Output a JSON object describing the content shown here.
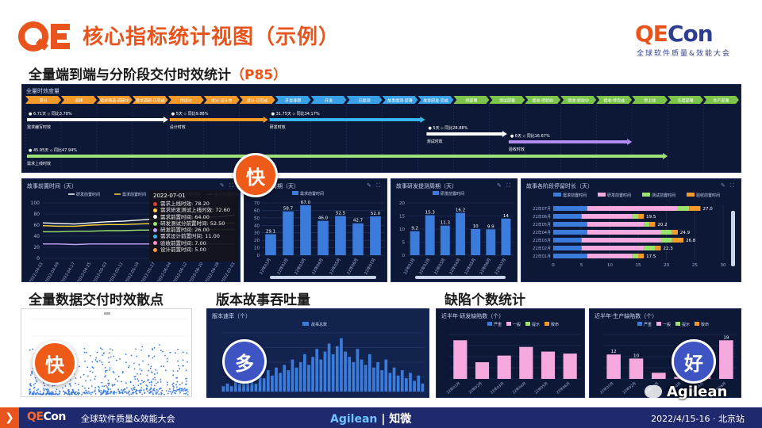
{
  "header": {
    "logo_text": "QE",
    "title": "核心指标统计视图（示例）",
    "brand_qe": "QE",
    "brand_con": "Con",
    "brand_subtitle": "全球软件质量&效能大会"
  },
  "sections": {
    "end_to_end_title": "全量端到端与分阶段交付时效统计",
    "end_to_end_ref": "（P85）",
    "scatter_title": "全量数据交付时效散点",
    "throughput_title": "版本故事吞吐量",
    "defect_title": "缺陷个数统计"
  },
  "badges": {
    "fast_1": "快",
    "fast_2": "快",
    "many": "多",
    "good": "好"
  },
  "gantt": {
    "header": "全量时效度量",
    "stages": [
      "需分",
      "选择",
      "需求筛选·调研中",
      "需求调研·已完成",
      "待设计",
      "设计·设计中",
      "设计·已完成",
      "开发排期",
      "开发",
      "已提测",
      "故事提测·部署",
      "故事研发·完成",
      "待部署",
      "测试部署",
      "验收·待验收",
      "验收·验收中",
      "验收·待完成",
      "待上线",
      "灰度部署",
      "生产部署"
    ],
    "stage_colors": [
      "#f39a2a",
      "#f39a2a",
      "#f39a2a",
      "#f39a2a",
      "#f39a2a",
      "#f39a2a",
      "#f39a2a",
      "#3aa0e8",
      "#3aa0e8",
      "#3aa0e8",
      "#3aa0e8",
      "#3aa0e8",
      "#7cc54a",
      "#7cc54a",
      "#7cc54a",
      "#7cc54a",
      "#7cc54a",
      "#7cc54a",
      "#7cc54a",
      "#7cc54a"
    ],
    "bars": [
      {
        "label": "需求编写时效",
        "value": "6.71天",
        "pct": "同比3.78%",
        "color": "#ffffff"
      },
      {
        "label": "设计时效",
        "value": "5天",
        "pct": "同比9.88%",
        "color": "#f39a2a"
      },
      {
        "label": "研发时效",
        "value": "31.75天",
        "pct": "同比34.17%",
        "color": "#37b6f0"
      },
      {
        "label": "测试时效",
        "value": "5天",
        "pct": "同比28.88%",
        "color": "#ffffff"
      },
      {
        "label": "验收时效",
        "value": "6天",
        "pct": "同比16.67%",
        "color": "#b28cf2"
      },
      {
        "label": "需求上线时效",
        "value": "45.95天",
        "pct": "同比47.94%",
        "color": "#9fe27a"
      }
    ]
  },
  "panels": {
    "line_title": "故事前置时间（天）",
    "line_legend": [
      "研发前置时间",
      "需求前置时间",
      "需求设计前置时间",
      "设计前置时间"
    ],
    "dev_cycle_title": "故事开发周期（天）",
    "dev_cycle_legend": "需求前置时间",
    "dev_test_title": "故事研发提测周期（天）",
    "dev_test_legend": "研发前置时间",
    "stage_title": "故事各阶段停留时长（天）",
    "stage_legend": [
      "需求前置时间",
      "研发前置时间",
      "测试前置时间",
      "验收前置时间"
    ],
    "throughput_title": "版本速率（个）",
    "throughput_legend": "故事总数",
    "defect_left_title": "近半年·研发缺陷数（个）",
    "defect_right_title": "近半年·生产缺陷数（个）",
    "defect_legend": [
      "严重",
      "一般",
      "提示",
      "致命"
    ],
    "defect_right_values": [
      "12",
      "10",
      "19"
    ]
  },
  "tooltip": {
    "date": "2022-07-01",
    "rows": [
      {
        "text": "需求上线时效: 78.20",
        "color": "#e63a3a"
      },
      {
        "text": "需求研发测试上线时效: 72.60",
        "color": "#ffd23c"
      },
      {
        "text": "需求前置时间: 64.00",
        "color": "#ffffff"
      },
      {
        "text": "研发测试分前置时间: 52.50",
        "color": "#9be36a"
      },
      {
        "text": "研发前置时间: 26.00",
        "color": "#c6a2ff"
      },
      {
        "text": "需求设计前置时间: 11.00",
        "color": "#37b6f0"
      },
      {
        "text": "验收前置时间: 7.00",
        "color": "#ff8ad0"
      },
      {
        "text": "设计前置时间: 5.00",
        "color": "#ff9c3a"
      }
    ]
  },
  "chart_data": [
    {
      "type": "line",
      "title": "故事前置时间（天）",
      "x": [
        "2022-04-01",
        "2022-04-09",
        "2022-04-17",
        "2022-04-25",
        "2022-05-03",
        "2022-05-11",
        "2022-05-19",
        "2022-05-27",
        "2022-06-04",
        "2022-06-12",
        "2022-06-20",
        "2022-06-28",
        "2022-07-01"
      ],
      "ylim": [
        0,
        100
      ],
      "yticks": [
        "0",
        "20",
        "40",
        "60",
        "80",
        "100"
      ],
      "series": [
        {
          "name": "研发前置时间",
          "values": [
            64,
            63,
            62,
            64,
            66,
            67,
            69,
            71,
            72,
            73,
            74,
            75,
            78
          ],
          "color": "#ffffff"
        },
        {
          "name": "需求前置时间",
          "values": [
            59,
            58,
            58,
            60,
            61,
            61,
            62,
            63,
            64,
            64,
            64,
            63,
            64
          ],
          "color": "#ffd23c"
        },
        {
          "name": "需求设计前置时间",
          "values": [
            48,
            48,
            49,
            49,
            50,
            50,
            51,
            51,
            52,
            52,
            52,
            52,
            52
          ],
          "color": "#9be36a"
        },
        {
          "name": "设计前置时间",
          "values": [
            26,
            26,
            25,
            26,
            26,
            26,
            26,
            26,
            26,
            26,
            26,
            26,
            26
          ],
          "color": "#c6a2ff"
        }
      ]
    },
    {
      "type": "bar",
      "title": "故事开发周期（天）",
      "categories": [
        "22年01月",
        "22年02月",
        "22年03月",
        "22年04月",
        "22年05月",
        "22年06月",
        "22年07月"
      ],
      "values": [
        28.1,
        58.7,
        67.0,
        46.0,
        52.5,
        42.7,
        52.0
      ],
      "labels": [
        "29.1",
        "58.7",
        "67.0",
        "46.0",
        "52.5",
        "42.7",
        "52.0"
      ],
      "ylim": [
        0,
        70
      ],
      "yticks": [
        "0",
        "10",
        "20",
        "30",
        "40",
        "50",
        "60",
        "70"
      ]
    },
    {
      "type": "bar",
      "title": "故事研发提测周期（天）",
      "categories": [
        "22年01月",
        "22年02月",
        "22年03月",
        "22年04月",
        "22年05月",
        "22年06月",
        "22年07月"
      ],
      "values": [
        9.2,
        15.3,
        11.3,
        16.2,
        10.0,
        9.9,
        14.0
      ],
      "ylim": [
        0,
        20
      ],
      "yticks": [
        "0",
        "5",
        "10",
        "15",
        "20"
      ]
    },
    {
      "type": "bar",
      "title": "故事各阶段停留时长（天）",
      "categories": [
        "22年07月",
        "22年06月",
        "22年05月",
        "22年04月",
        "22年03月",
        "22年02月",
        "22年01月"
      ],
      "series": [
        {
          "name": "需求前置时间",
          "values": [
            6,
            5,
            6,
            6,
            5,
            5,
            6
          ],
          "color": "#3b7bdc"
        },
        {
          "name": "研发前置时间",
          "values": [
            16,
            9,
            10,
            13,
            14,
            11,
            8
          ],
          "color": "#f6a9df"
        },
        {
          "name": "测试前置时间",
          "values": [
            2,
            1,
            1,
            2,
            2,
            2,
            1
          ],
          "color": "#9be36a"
        },
        {
          "name": "验收前置时间",
          "values": [
            2,
            1,
            1,
            1,
            2,
            1,
            1
          ],
          "color": "#f39a2a"
        }
      ],
      "labels": [
        "27.0",
        "19.5",
        "20.2",
        "24.9",
        "26.8",
        "22.3",
        "17.5"
      ],
      "xlim": [
        0,
        30
      ],
      "xticks": [
        "0",
        "5",
        "10",
        "15",
        "20",
        "25",
        "30"
      ]
    },
    {
      "type": "scatter",
      "title": "",
      "n_points": 600,
      "ylim": [
        0,
        1
      ]
    },
    {
      "type": "bar",
      "title": "版本速率（个）",
      "values": [
        2,
        3,
        2,
        4,
        3,
        5,
        4,
        6,
        3,
        7,
        5,
        8,
        6,
        9,
        7,
        10,
        8,
        12,
        9,
        11,
        14,
        10,
        13,
        16,
        12,
        15,
        18,
        14,
        17,
        20,
        15,
        13,
        11,
        16,
        12,
        10,
        14,
        9,
        11,
        8,
        12,
        7,
        9,
        6,
        8,
        5,
        7,
        4,
        6,
        3
      ],
      "ylim": [
        0,
        22
      ]
    },
    {
      "type": "bar",
      "title": "近半年·研发缺陷数（个）",
      "categories": [
        "22年01月",
        "22年02月",
        "22年03月",
        "22年04月",
        "22年05月",
        "22年06月"
      ],
      "series": [
        {
          "name": "一般",
          "values": [
            58,
            25,
            35,
            48,
            41,
            38
          ],
          "color": "#f6a9df"
        }
      ]
    },
    {
      "type": "bar",
      "title": "近半年·生产缺陷数（个）",
      "categories": [
        "22年01月",
        "22年02月",
        "22年03月",
        "22年04月",
        "22年05月",
        "22年06月"
      ],
      "series": [
        {
          "name": "一般",
          "values": [
            12,
            10,
            3,
            1,
            2,
            19
          ],
          "color": "#f6a9df"
        }
      ]
    }
  ],
  "watermark": "Agilean",
  "footer": {
    "brand_qe": "QE",
    "brand_con": "Con",
    "name": "全球软件质量&效能大会",
    "partner_1": "Agilean",
    "partner_2": "知微",
    "date": "2022/4/15-16 · 北京站",
    "arrow": "❯"
  }
}
